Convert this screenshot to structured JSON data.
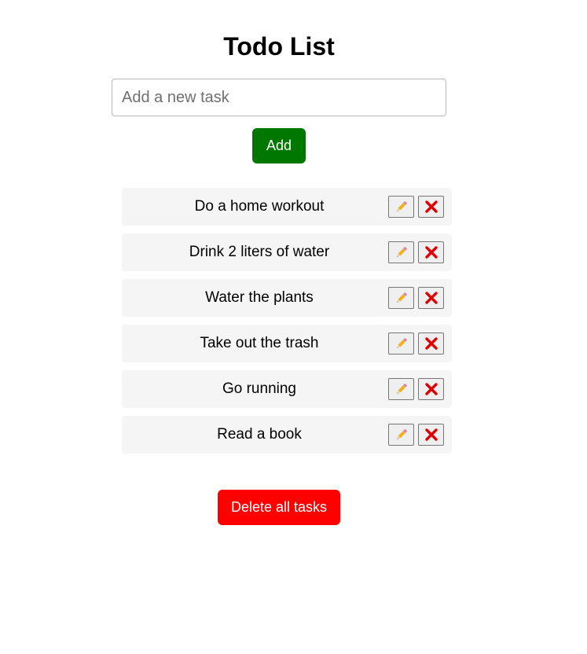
{
  "app": {
    "title": "Todo List"
  },
  "new_task": {
    "placeholder": "Add a new task",
    "value": "",
    "add_label": "Add"
  },
  "tasks": [
    {
      "text": "Do a home workout",
      "edit_icon": "pencil-icon",
      "delete_icon": "cross-mark-icon"
    },
    {
      "text": "Drink 2 liters of water",
      "edit_icon": "pencil-icon",
      "delete_icon": "cross-mark-icon"
    },
    {
      "text": "Water the plants",
      "edit_icon": "pencil-icon",
      "delete_icon": "cross-mark-icon"
    },
    {
      "text": "Take out the trash",
      "edit_icon": "pencil-icon",
      "delete_icon": "cross-mark-icon"
    },
    {
      "text": "Go running",
      "edit_icon": "pencil-icon",
      "delete_icon": "cross-mark-icon"
    },
    {
      "text": "Read a book",
      "edit_icon": "pencil-icon",
      "delete_icon": "cross-mark-icon"
    }
  ],
  "footer": {
    "delete_all_label": "Delete all tasks"
  },
  "colors": {
    "add_button": "#007800",
    "delete_all_button": "#ff0000",
    "task_background": "#f5f5f5",
    "delete_icon": "#e00000"
  }
}
